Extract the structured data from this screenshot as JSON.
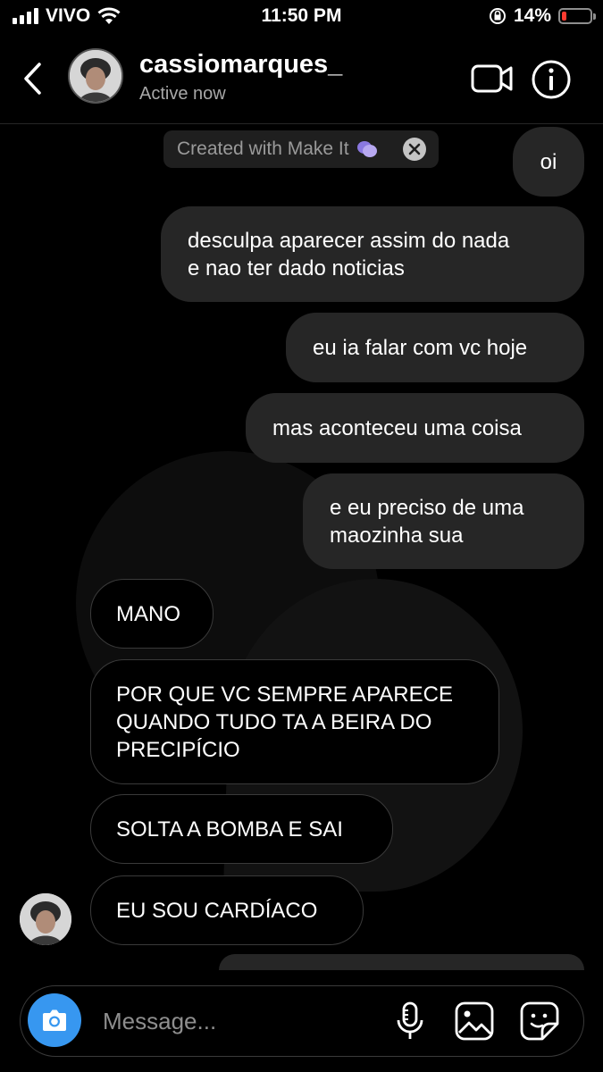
{
  "status_bar": {
    "carrier": "VIVO",
    "time": "11:50 PM",
    "battery": "14%"
  },
  "header": {
    "name": "cassiomarques_",
    "status": "Active now"
  },
  "banner": {
    "text": "Created with Make It"
  },
  "messages": [
    {
      "side": "sent",
      "text": "oi"
    },
    {
      "side": "sent",
      "text": "desculpa aparecer assim do nada\ne nao ter dado noticias"
    },
    {
      "side": "sent",
      "text": "eu ia falar com vc hoje"
    },
    {
      "side": "sent",
      "text": "mas aconteceu uma coisa"
    },
    {
      "side": "sent",
      "text": "e eu preciso de uma\nmaozinha sua"
    },
    {
      "side": "received",
      "text": "MANO"
    },
    {
      "side": "received",
      "text": "POR QUE VC SEMPRE APARECE\nQUANDO TUDO TA A BEIRA DO\nPRECIPÍCIO"
    },
    {
      "side": "received",
      "text": "SOLTA A BOMBA E SAI"
    },
    {
      "side": "received",
      "text": "EU SOU CARDÍACO"
    }
  ],
  "composer": {
    "placeholder": "Message..."
  },
  "icons": [
    "back-icon",
    "video-call-icon",
    "info-icon",
    "camera-icon",
    "microphone-icon",
    "gallery-icon",
    "sticker-icon",
    "close-icon",
    "wifi-icon",
    "lock-rotation-icon"
  ],
  "colors": {
    "accent": "#3797f0",
    "sent_bubble": "#262626",
    "battery_low": "#ff3b30"
  }
}
